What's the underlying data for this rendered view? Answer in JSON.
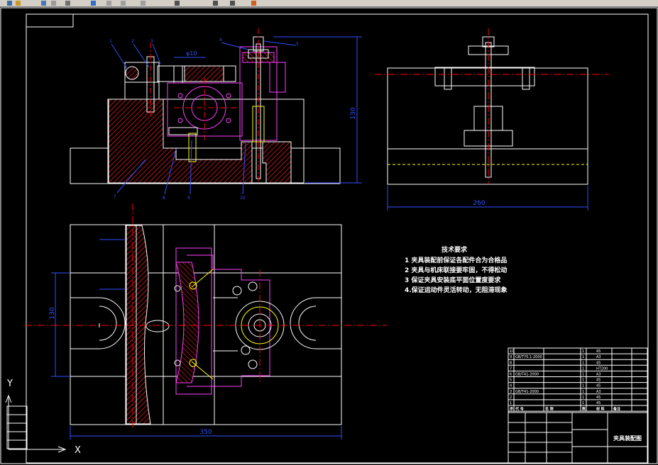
{
  "drawing": {
    "title_block_name": "夹具装配图",
    "tech_req": {
      "title": "技术要求",
      "items": [
        "1  夹具装配前保证各配件合为合格品",
        "2  夹具与机床联接要牢固，不得松动",
        "3  保证夹具安装底平面位置度要求",
        "4.保证运动件灵活转动，无阻滞现象"
      ]
    },
    "dims": {
      "front_height": "130",
      "side_width": "260",
      "plan_width": "350",
      "plan_height": "130",
      "phi10": "φ10"
    },
    "part_numbers": [
      "1",
      "2",
      "3",
      "4",
      "5",
      "6",
      "7",
      "8",
      "9",
      "10"
    ],
    "bom": {
      "header": [
        "序",
        "代 号",
        "名 称",
        "数",
        "材 料",
        "备注"
      ],
      "rows": [
        [
          "10",
          "",
          "",
          "1",
          "45",
          ""
        ],
        [
          "9",
          "GB/T70.1-2000",
          "",
          "1",
          "A3",
          ""
        ],
        [
          "8",
          "",
          "",
          "1",
          "45",
          ""
        ],
        [
          "7",
          "",
          "",
          "1",
          "HT200",
          ""
        ],
        [
          "6",
          "GB/T41-2000",
          "",
          "1",
          "A3",
          ""
        ],
        [
          "5",
          "",
          "",
          "1",
          "45",
          ""
        ],
        [
          "4",
          "",
          "",
          "1",
          "45",
          ""
        ],
        [
          "3",
          "GB/T41-2000",
          "",
          "1",
          "A3",
          ""
        ],
        [
          "2",
          "",
          "",
          "1",
          "45",
          ""
        ],
        [
          "1",
          "",
          "",
          "1",
          "45",
          ""
        ]
      ]
    },
    "axis": {
      "y": "Y",
      "x": "X"
    }
  },
  "colors": {
    "background": "#000000",
    "outline": "#ffffff",
    "section": "#ff2020",
    "magenta": "#ff40ff",
    "yellow": "#ffff00",
    "dimension": "#3050ff",
    "centerline": "#ff0000"
  }
}
